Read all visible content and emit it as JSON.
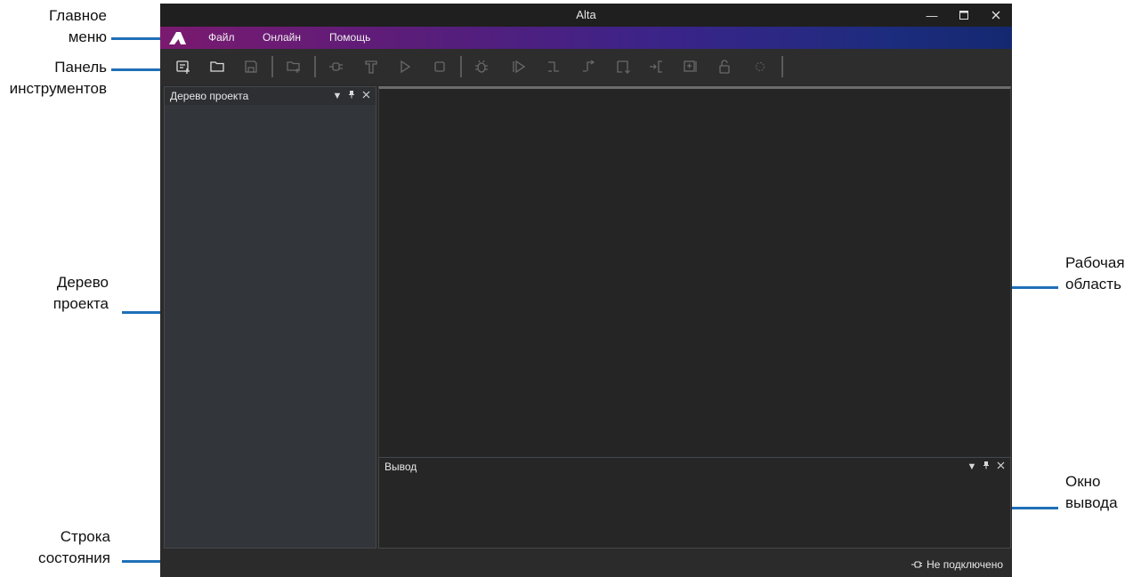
{
  "annotations": {
    "main_menu": [
      "Главное",
      "меню"
    ],
    "toolbar": [
      "Панель",
      "инструментов"
    ],
    "project_tree": [
      "Дерево",
      "проекта"
    ],
    "status_bar": [
      "Строка",
      "состояния"
    ],
    "workspace": [
      "Рабочая",
      "область"
    ],
    "output_window": [
      "Окно",
      "вывода"
    ]
  },
  "window": {
    "title": "Alta",
    "controls": [
      "minimize-icon",
      "maximize-icon",
      "close-icon"
    ]
  },
  "menu": {
    "items": [
      {
        "label": "Файл"
      },
      {
        "label": "Онлайн"
      },
      {
        "label": "Помощь"
      }
    ]
  },
  "toolbar": {
    "buttons": [
      {
        "icon": "new-project-icon",
        "enabled": true
      },
      {
        "icon": "open-folder-icon",
        "enabled": true
      },
      {
        "icon": "save-icon",
        "enabled": false
      },
      {
        "icon": "new-file-icon",
        "enabled": false
      },
      {
        "icon": "connect-icon",
        "enabled": false
      },
      {
        "icon": "build-icon",
        "enabled": false
      },
      {
        "icon": "run-icon",
        "enabled": false
      },
      {
        "icon": "stop-icon",
        "enabled": false
      },
      {
        "icon": "debug-icon",
        "enabled": false
      },
      {
        "icon": "continue-icon",
        "enabled": false
      },
      {
        "icon": "step-over-icon",
        "enabled": false
      },
      {
        "icon": "step-out-icon",
        "enabled": false
      },
      {
        "icon": "step-into-icon",
        "enabled": false
      },
      {
        "icon": "run-to-cursor-icon",
        "enabled": false
      },
      {
        "icon": "watch-icon",
        "enabled": false
      },
      {
        "icon": "unlock-icon",
        "enabled": false
      },
      {
        "icon": "breakpoint-icon",
        "enabled": false
      }
    ]
  },
  "project_tree": {
    "title": "Дерево проекта"
  },
  "output": {
    "title": "Вывод"
  },
  "status": {
    "connection": "Не подключено"
  },
  "colors": {
    "accent_line": "#1f6fb8",
    "menu_gradient_start": "#7a1a6f",
    "menu_gradient_end": "#142870"
  }
}
